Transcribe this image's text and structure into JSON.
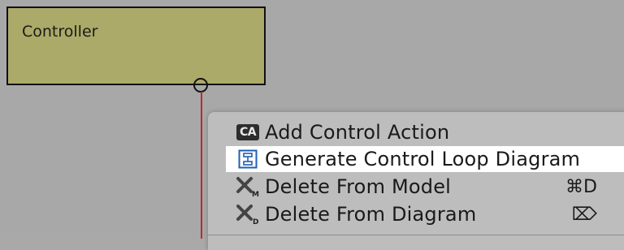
{
  "diagram": {
    "controller_title": "Controller"
  },
  "context_menu": {
    "items": [
      {
        "label": "Add Control Action",
        "icon": "control-action-icon",
        "badge": "CA",
        "shortcut": ""
      },
      {
        "label": "Generate Control Loop Diagram",
        "icon": "control-loop-diagram-icon",
        "shortcut": "",
        "highlighted": true
      },
      {
        "label": "Delete From Model",
        "icon": "delete-from-model-icon",
        "shortcut": "⌘D"
      },
      {
        "label": "Delete From Diagram",
        "icon": "delete-from-diagram-icon",
        "shortcut": "⌦"
      }
    ]
  },
  "colors": {
    "canvas": "#a8a8a8",
    "controller_fill": "#acaa68",
    "connector": "#c0282a",
    "menu_bg": "#bdbdbd",
    "highlight": "#ffffff"
  }
}
